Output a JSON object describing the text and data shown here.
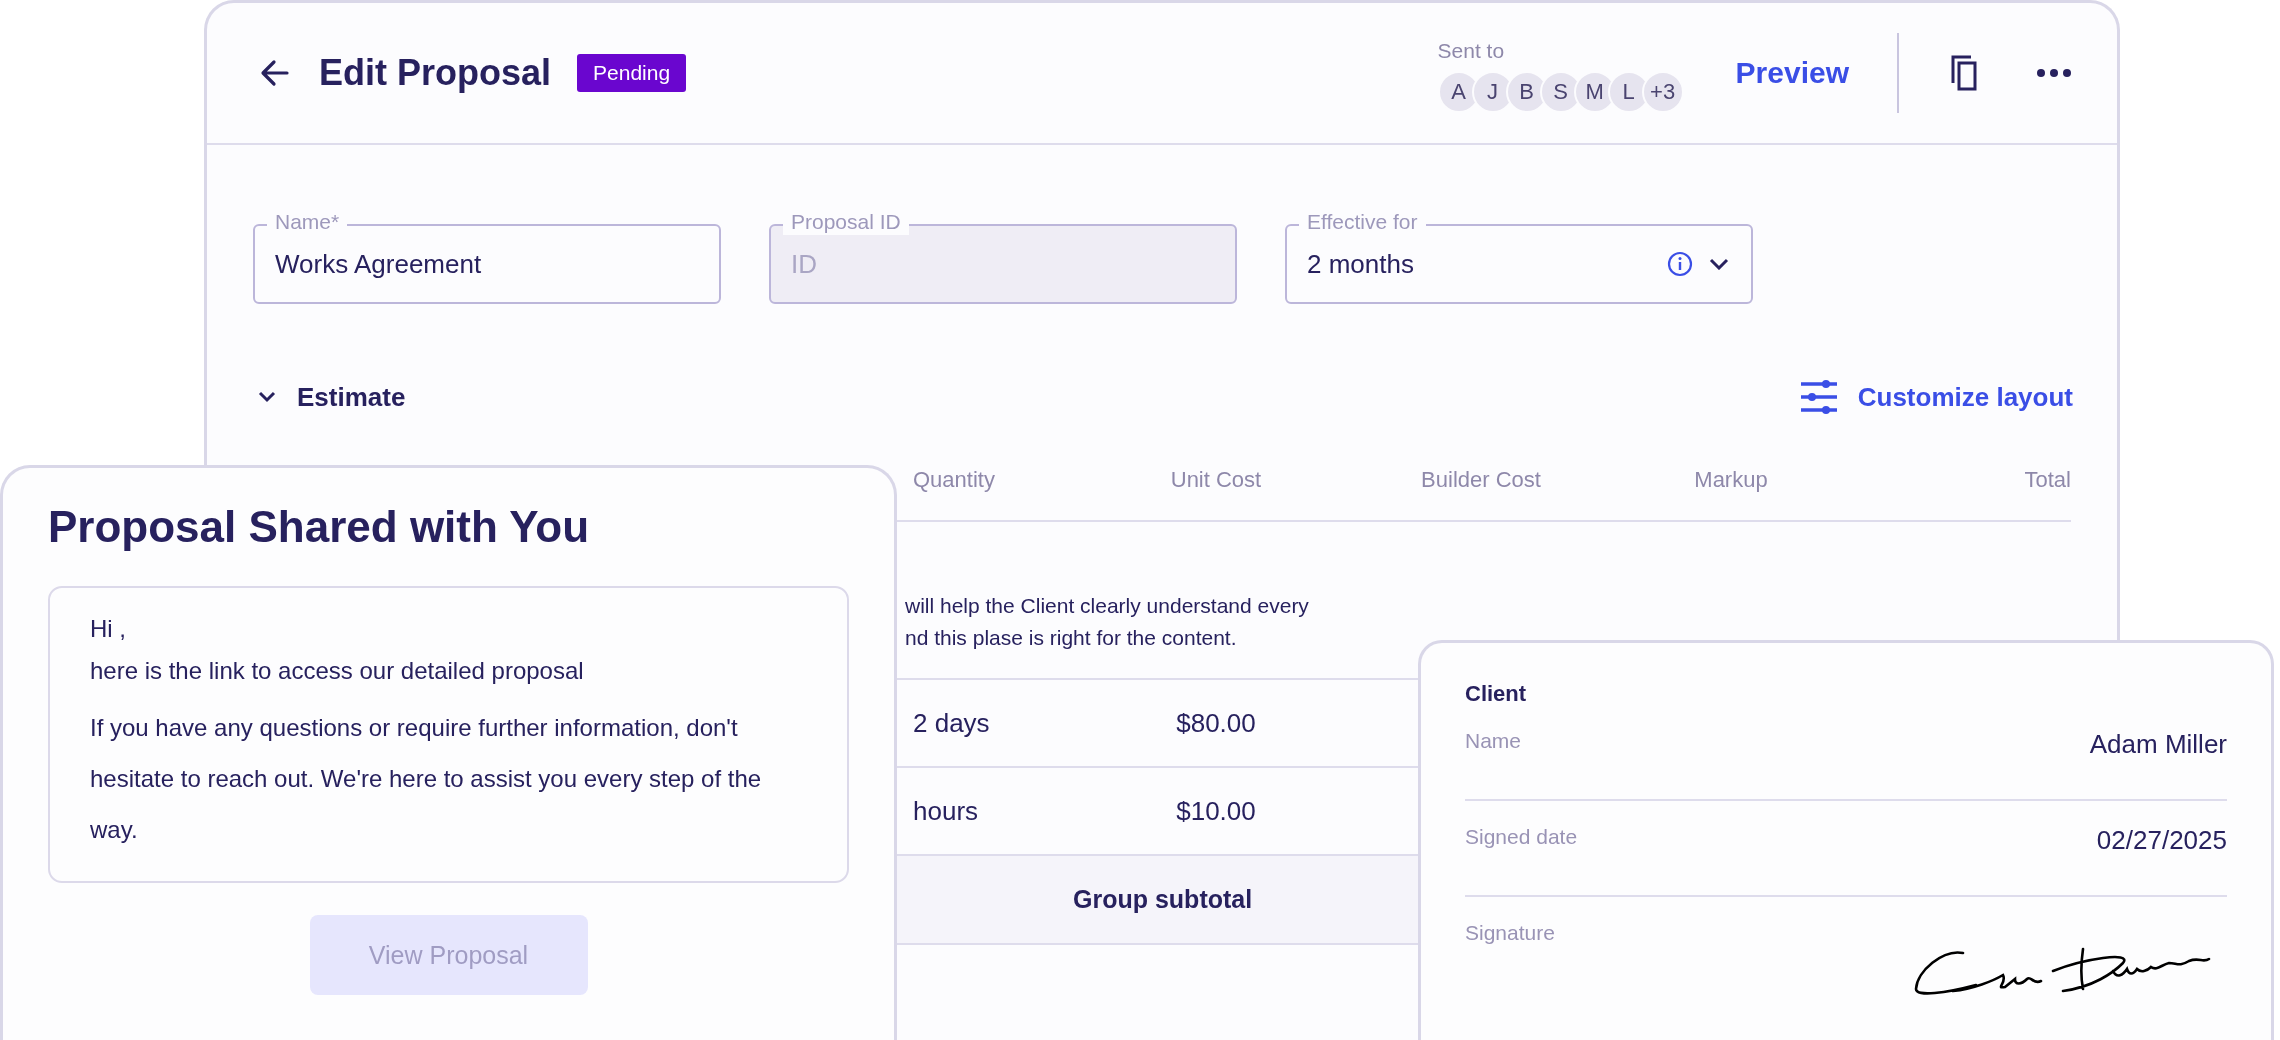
{
  "header": {
    "title": "Edit Proposal",
    "status": "Pending",
    "sent_to_label": "Sent to",
    "recipients": [
      "A",
      "J",
      "B",
      "S",
      "M",
      "L",
      "+3"
    ],
    "preview": "Preview"
  },
  "fields": [
    {
      "kind": "text",
      "label": "Name*",
      "value": "Works Agreement",
      "disabled": false
    },
    {
      "kind": "text",
      "label": "Proposal ID",
      "placeholder": "ID",
      "disabled": true
    },
    {
      "kind": "select",
      "label": "Effective for",
      "value": "2 months",
      "disabled": false
    }
  ],
  "estimate": {
    "title": "Estimate",
    "expanded": true,
    "customize": "Customize layout",
    "columns": [
      "Quantity",
      "Unit Cost",
      "Builder Cost",
      "Markup",
      "Total"
    ],
    "description": [
      "will help the Client clearly understand every",
      "nd this plase is right for the content."
    ],
    "rows": [
      {
        "quantity": "2 days",
        "unit_cost": "$80.00"
      },
      {
        "quantity": "hours",
        "unit_cost": "$10.00"
      }
    ],
    "subtotal": "Group subtotal"
  },
  "share_card": {
    "title": "Proposal Shared with You",
    "greeting": "Hi ,",
    "intro": "here is the link to access our detailed proposal",
    "body": "If you have any questions or require further information, don't hesitate to reach out. We're here to assist you every step of the way.",
    "button": "View Proposal",
    "button_disabled": true
  },
  "client_card": {
    "title": "Client",
    "rows": [
      {
        "kind": "text",
        "label": "Name",
        "value": "Adam Miller"
      },
      {
        "kind": "text",
        "label": "Signed date",
        "value": "02/27/2025"
      },
      {
        "kind": "signature",
        "label": "Signature"
      }
    ]
  }
}
